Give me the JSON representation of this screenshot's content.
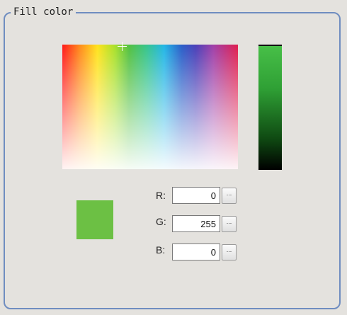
{
  "group": {
    "title": "Fill color"
  },
  "picker": {
    "hue_x": 0.35,
    "luminance": 1.0
  },
  "preview": {
    "color": "#6cc044"
  },
  "rgb": [
    {
      "label": "R:",
      "value": "0",
      "button": "..."
    },
    {
      "label": "G:",
      "value": "255",
      "button": "..."
    },
    {
      "label": "B:",
      "value": "0",
      "button": "..."
    }
  ]
}
